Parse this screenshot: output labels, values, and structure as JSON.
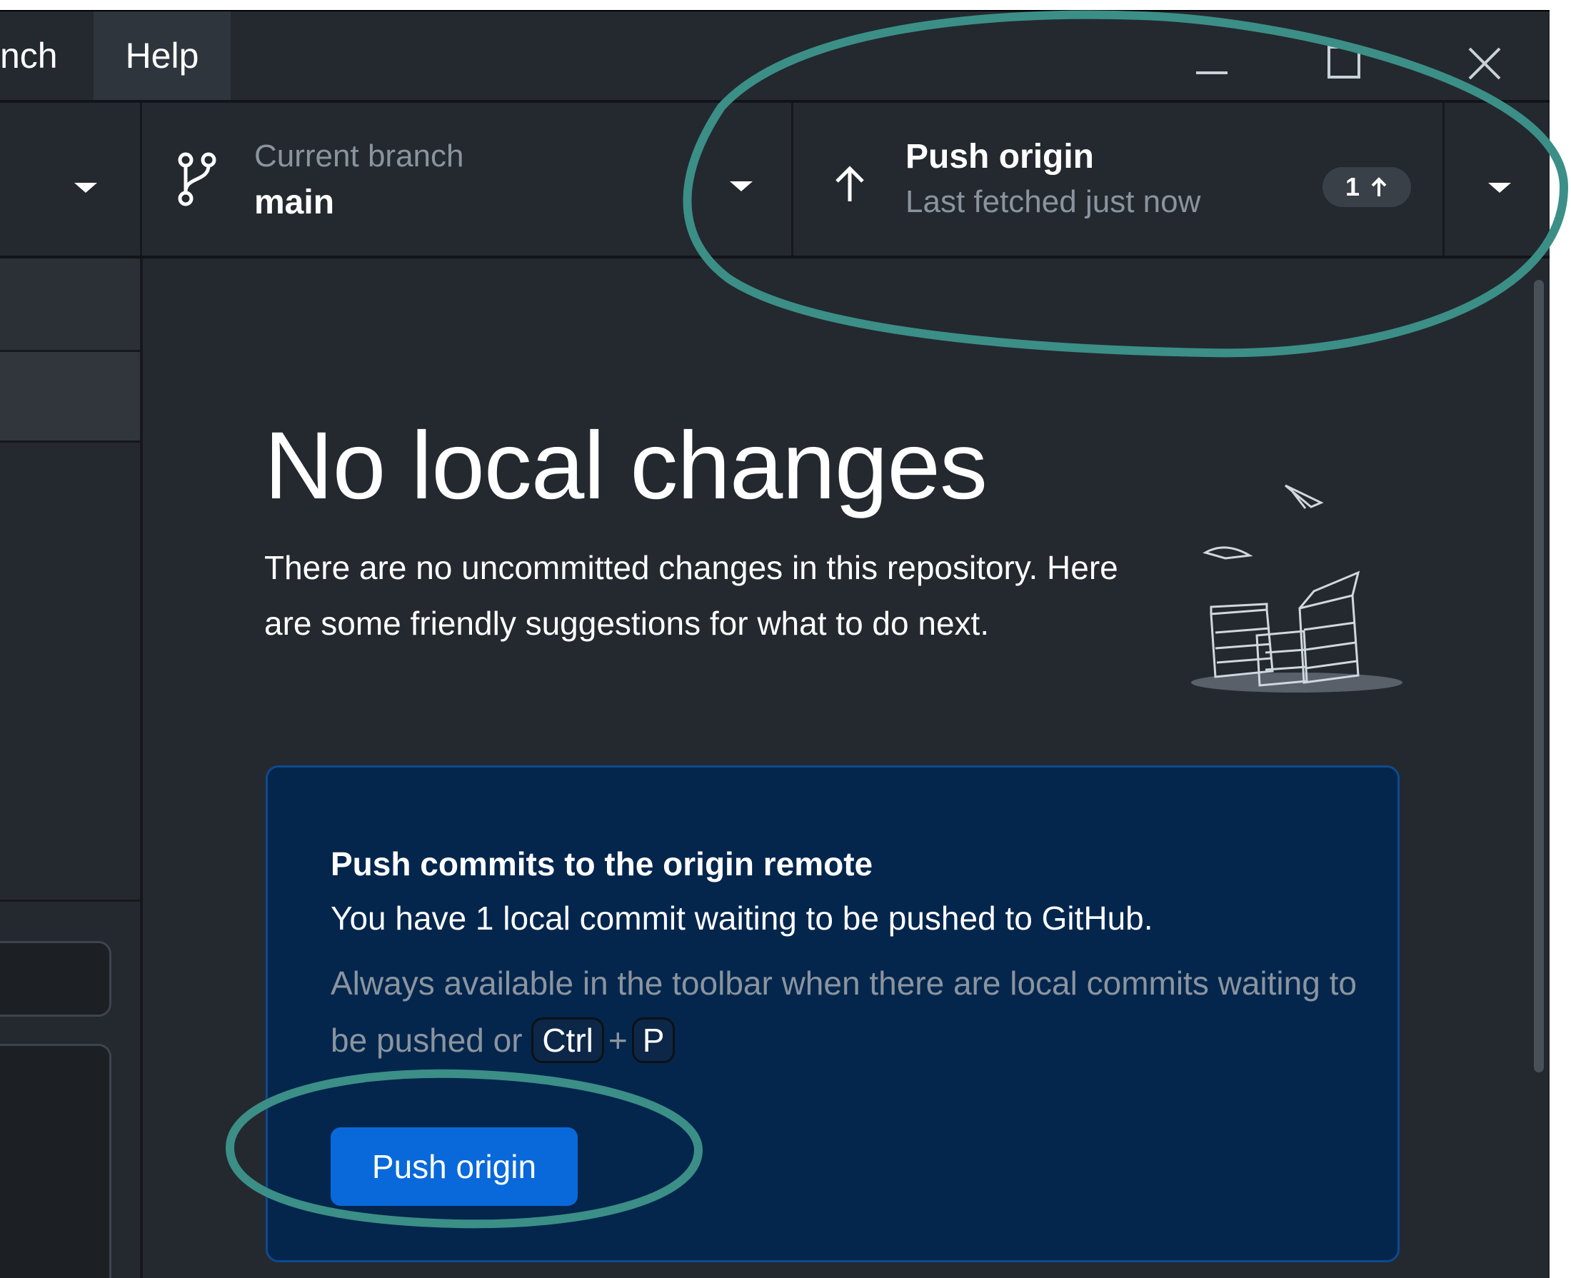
{
  "menu": {
    "branch_partial": "nch",
    "help": "Help"
  },
  "window_controls": [
    "minimize-icon",
    "maximize-icon",
    "close-icon"
  ],
  "toolbar": {
    "branch": {
      "label": "Current branch",
      "name": "main",
      "icon": "git-branch-icon"
    },
    "push": {
      "title": "Push origin",
      "subtitle": "Last fetched just now",
      "ahead_count": "1",
      "icon": "arrow-up-icon"
    }
  },
  "main": {
    "title": "No local changes",
    "description": "There are no uncommitted changes in this repository. Here are some friendly suggestions for what to do next.",
    "callout": {
      "title": "Push commits to the origin remote",
      "description": "You have 1 local commit waiting to be pushed to GitHub.",
      "hint": "Always available in the toolbar when there are local commits waiting to be pushed or",
      "shortcut_key1": "Ctrl",
      "shortcut_plus": "+",
      "shortcut_key2": "P",
      "button_label": "Push origin"
    }
  },
  "colors": {
    "background": "#24292f",
    "callout_background": "#04264d",
    "button": "#0969da",
    "annotation": "#3b8f86"
  }
}
